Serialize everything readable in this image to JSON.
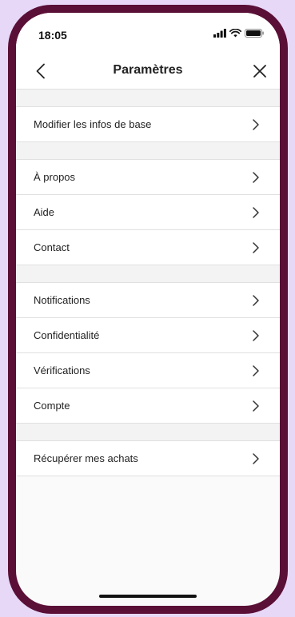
{
  "status_bar": {
    "time": "18:05"
  },
  "nav": {
    "title": "Paramètres"
  },
  "groups": [
    {
      "items": [
        {
          "label": "Modifier les infos de base"
        }
      ]
    },
    {
      "items": [
        {
          "label": "À propos"
        },
        {
          "label": "Aide"
        },
        {
          "label": "Contact"
        }
      ]
    },
    {
      "items": [
        {
          "label": "Notifications"
        },
        {
          "label": "Confidentialité"
        },
        {
          "label": "Vérifications"
        },
        {
          "label": "Compte"
        }
      ]
    },
    {
      "items": [
        {
          "label": "Récupérer mes achats"
        }
      ]
    }
  ],
  "icons": {
    "back": "chevron-left-icon",
    "close": "close-icon",
    "row": "chevron-right-icon",
    "signal": "signal-icon",
    "wifi": "wifi-icon",
    "battery": "battery-icon"
  },
  "colors": {
    "frame": "#5a0f36",
    "background": "#e7d8f8"
  }
}
